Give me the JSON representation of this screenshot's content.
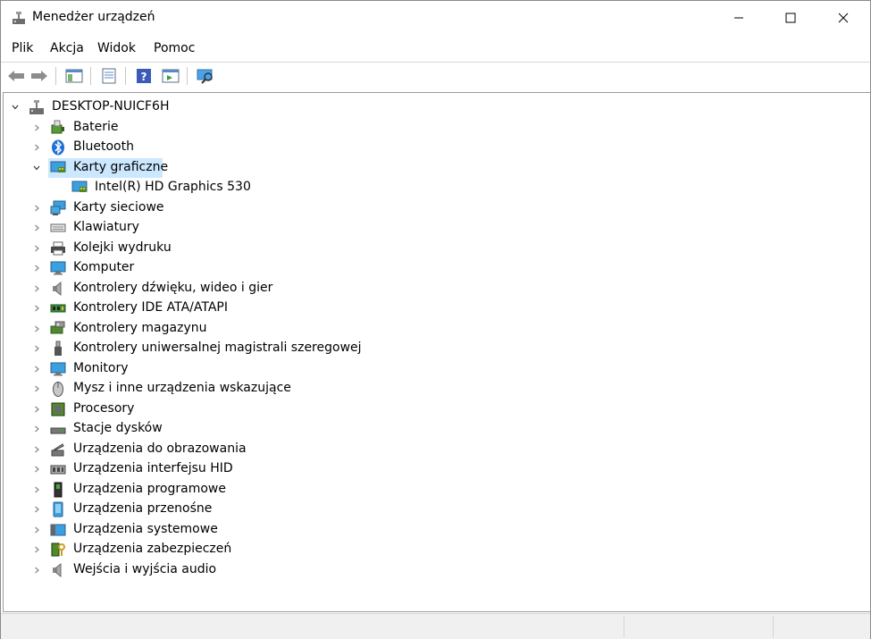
{
  "window": {
    "title": "Menedżer urządzeń"
  },
  "menu": {
    "items": [
      "Plik",
      "Akcja",
      "Widok",
      "Pomoc"
    ]
  },
  "toolbar": {
    "buttons": [
      "back-arrow-icon",
      "forward-arrow-icon",
      "show-hide-tree-icon",
      "properties-icon",
      "help-icon",
      "action-pane-icon",
      "scan-hardware-icon"
    ]
  },
  "tree": {
    "root": "DESKTOP-NUICF6H",
    "categories": [
      {
        "label": "Baterie",
        "icon": "battery-icon",
        "expanded": false
      },
      {
        "label": "Bluetooth",
        "icon": "bluetooth-icon",
        "expanded": false
      },
      {
        "label": "Karty graficzne",
        "icon": "display-adapter-icon",
        "expanded": true,
        "selected": true
      },
      {
        "label": "Karty sieciowe",
        "icon": "network-adapter-icon",
        "expanded": false
      },
      {
        "label": "Klawiatury",
        "icon": "keyboard-icon",
        "expanded": false
      },
      {
        "label": "Kolejki wydruku",
        "icon": "printer-icon",
        "expanded": false
      },
      {
        "label": "Komputer",
        "icon": "computer-icon",
        "expanded": false
      },
      {
        "label": "Kontrolery dźwięku, wideo i gier",
        "icon": "speaker-icon",
        "expanded": false
      },
      {
        "label": "Kontrolery IDE ATA/ATAPI",
        "icon": "ide-controller-icon",
        "expanded": false
      },
      {
        "label": "Kontrolery magazynu",
        "icon": "storage-controller-icon",
        "expanded": false
      },
      {
        "label": "Kontrolery uniwersalnej magistrali szeregowej",
        "icon": "usb-icon",
        "expanded": false
      },
      {
        "label": "Monitory",
        "icon": "monitor-icon",
        "expanded": false
      },
      {
        "label": "Mysz i inne urządzenia wskazujące",
        "icon": "mouse-icon",
        "expanded": false
      },
      {
        "label": "Procesory",
        "icon": "processor-icon",
        "expanded": false
      },
      {
        "label": "Stacje dysków",
        "icon": "disk-drive-icon",
        "expanded": false
      },
      {
        "label": "Urządzenia do obrazowania",
        "icon": "imaging-device-icon",
        "expanded": false
      },
      {
        "label": "Urządzenia interfejsu HID",
        "icon": "hid-icon",
        "expanded": false
      },
      {
        "label": "Urządzenia programowe",
        "icon": "software-device-icon",
        "expanded": false
      },
      {
        "label": "Urządzenia przenośne",
        "icon": "portable-device-icon",
        "expanded": false
      },
      {
        "label": "Urządzenia systemowe",
        "icon": "system-device-icon",
        "expanded": false
      },
      {
        "label": "Urządzenia zabezpieczeń",
        "icon": "security-device-icon",
        "expanded": false
      },
      {
        "label": "Wejścia i wyjścia audio",
        "icon": "audio-io-icon",
        "expanded": false
      }
    ],
    "expanded_child": {
      "label": "Intel(R) HD Graphics 530",
      "icon": "display-adapter-icon"
    }
  },
  "colors": {
    "selection": "#cce8ff",
    "accent": "#1e90ff"
  }
}
